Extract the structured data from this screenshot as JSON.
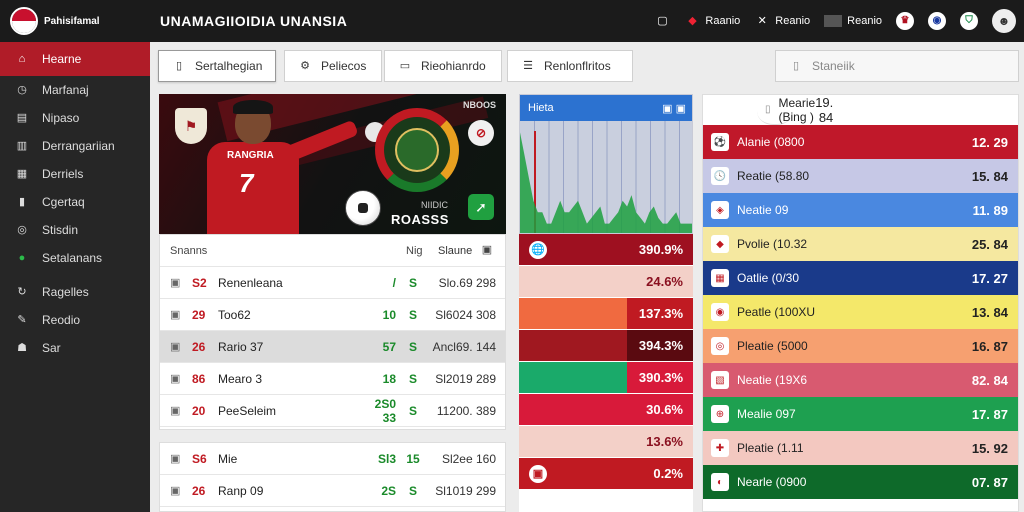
{
  "brand": {
    "name": "Pahisifamal",
    "flag_colors": [
      "#c8102e",
      "#ffffff"
    ]
  },
  "app": {
    "title": "UNAMAGIIOIDIA UNANSIA"
  },
  "topnav": [
    {
      "icon": "monitor-icon",
      "label": ""
    },
    {
      "icon": "ticket-icon",
      "label": "Raanio"
    },
    {
      "icon": "tools-icon",
      "label": "Reanio"
    },
    {
      "icon": "screen-icon",
      "label": "Reanio"
    },
    {
      "icon": "trophy-icon",
      "label": ""
    },
    {
      "icon": "globe-icon",
      "label": ""
    },
    {
      "icon": "shield-icon",
      "label": ""
    },
    {
      "icon": "avatar",
      "label": ""
    }
  ],
  "sidebar": {
    "items": [
      {
        "icon": "home-icon",
        "label": "Hearne",
        "active": true
      },
      {
        "icon": "clock-icon",
        "label": "Marfanaj"
      },
      {
        "icon": "list-icon",
        "label": "Nipaso"
      },
      {
        "icon": "chart-icon",
        "label": "Derrangariian"
      },
      {
        "icon": "calendar-icon",
        "label": "Derriels"
      },
      {
        "icon": "flag-icon",
        "label": "Cgertaq"
      },
      {
        "icon": "circle-icon",
        "label": "Stisdin"
      },
      {
        "icon": "leaf-icon",
        "label": "Setalanans"
      },
      {
        "icon": "refresh-icon",
        "label": "Ragelles"
      },
      {
        "icon": "edit-icon",
        "label": "Reodio"
      },
      {
        "icon": "users-icon",
        "label": "Sar"
      }
    ]
  },
  "tabs": [
    {
      "icon": "file-icon",
      "label": "Sertalhegian"
    },
    {
      "icon": "settings-icon",
      "label": "Peliecos"
    },
    {
      "icon": "chat-icon",
      "label": "Rieohianrdo"
    },
    {
      "icon": "menu-icon",
      "label": "Renlonflritos"
    }
  ],
  "search": {
    "placeholder": "Staneiik"
  },
  "hero": {
    "tag": "NBOOS",
    "sub": "NIIDIC",
    "title": "ROASSS"
  },
  "table": {
    "header": {
      "name": "Snanns",
      "a": "",
      "b": "Nig",
      "c": "Slaune"
    },
    "rows": [
      {
        "rank": "S2",
        "name": "Renenleana",
        "a": "/",
        "b": "S",
        "c": "Slo.69  298",
        "sel": false
      },
      {
        "rank": "29",
        "name": "Too62",
        "a": "10",
        "b": "S",
        "c": "Sl6024  308",
        "sel": false
      },
      {
        "rank": "26",
        "name": "Rario 37",
        "a": "57",
        "b": "S",
        "c": "Ancl69.  144",
        "sel": true
      },
      {
        "rank": "86",
        "name": "Mearo 3",
        "a": "18",
        "b": "S",
        "c": "Sl2019  289",
        "sel": false
      },
      {
        "rank": "20",
        "name": "PeeSeleim",
        "a": "2S0 33",
        "b": "S",
        "c": "11200.  389",
        "sel": false
      }
    ],
    "rows2": [
      {
        "rank": "S6",
        "name": "Mie",
        "a": "Sl3",
        "b": "15",
        "c": "Sl2ee  160",
        "sel": false
      },
      {
        "rank": "26",
        "name": "Ranp 09",
        "a": "2S",
        "b": "S",
        "c": "Sl1019  299",
        "sel": false
      }
    ]
  },
  "chart_data": {
    "type": "area",
    "title": "Hieta",
    "legend": "Blue",
    "x_count": 40,
    "values": [
      0.9,
      0.7,
      0.5,
      0.3,
      0.2,
      0.2,
      0.1,
      0.1,
      0.2,
      0.3,
      0.2,
      0.2,
      0.25,
      0.3,
      0.2,
      0.1,
      0.15,
      0.2,
      0.25,
      0.1,
      0.1,
      0.15,
      0.2,
      0.3,
      0.25,
      0.35,
      0.2,
      0.15,
      0.1,
      0.2,
      0.25,
      0.15,
      0.1,
      0.1,
      0.15,
      0.2,
      0.1,
      0.1,
      0.1,
      0.1
    ],
    "ylim": [
      0,
      1
    ],
    "colors": {
      "area": "#1da040",
      "bg": "#c9cfde",
      "grid": "#7a88b8",
      "spike": "#c01a22"
    }
  },
  "percents": [
    {
      "value": "390.9%",
      "color": "#9e1020",
      "icon": "🌐"
    },
    {
      "value": "24.6%",
      "color": "#f3d0c8"
    },
    {
      "value": "137.3%",
      "color": "#c01a22",
      "split": "#f06a40"
    },
    {
      "value": "394.3%",
      "color": "#5a0a10",
      "split": "#a01820"
    },
    {
      "value": "390.3%",
      "color": "#d81a3a",
      "split": "#1aaa6a"
    },
    {
      "value": "30.6%",
      "color": "#d81a3a"
    },
    {
      "value": "13.6%",
      "color": "#f3d0c8"
    },
    {
      "value": "0.2%",
      "color": "#c01a22",
      "icon": "▣"
    }
  ],
  "list": {
    "header": {
      "label": "Mearie (Bing )",
      "value": "19. 84"
    },
    "rows": [
      {
        "label": "Alanie (0800",
        "value": "12. 29",
        "color": "#c0182a",
        "icon": "⚽"
      },
      {
        "label": "Reatie (58.80",
        "value": "15. 84",
        "color": "#c6c8e6",
        "text": "#222",
        "icon": "🕓"
      },
      {
        "label": "Neatie 09",
        "value": "11. 89",
        "color": "#4a88e0",
        "icon": "◈"
      },
      {
        "label": "Pvolie (10.32",
        "value": "25. 84",
        "color": "#f5e8a0",
        "text": "#222",
        "icon": "◆"
      },
      {
        "label": "Oatlie (0/30",
        "value": "17. 27",
        "color": "#1a3a8a",
        "icon": "▦"
      },
      {
        "label": "Peatle (100XU",
        "value": "13. 84",
        "color": "#f4e86a",
        "text": "#222",
        "icon": "◉"
      },
      {
        "label": "Pleatie (5000",
        "value": "16. 87",
        "color": "#f6a070",
        "text": "#222",
        "icon": "◎"
      },
      {
        "label": "Neatie (19X6",
        "value": "82. 84",
        "color": "#d85a70",
        "icon": "▧"
      },
      {
        "label": "Mealie 097",
        "value": "17. 87",
        "color": "#1ea050",
        "icon": "⊕"
      },
      {
        "label": "Pleatie (1.11",
        "value": "15. 92",
        "color": "#f3c8c0",
        "text": "#222",
        "icon": "✚"
      },
      {
        "label": "Nearle (0900",
        "value": "07. 87",
        "color": "#0e6a2a",
        "icon": "◐"
      }
    ]
  }
}
